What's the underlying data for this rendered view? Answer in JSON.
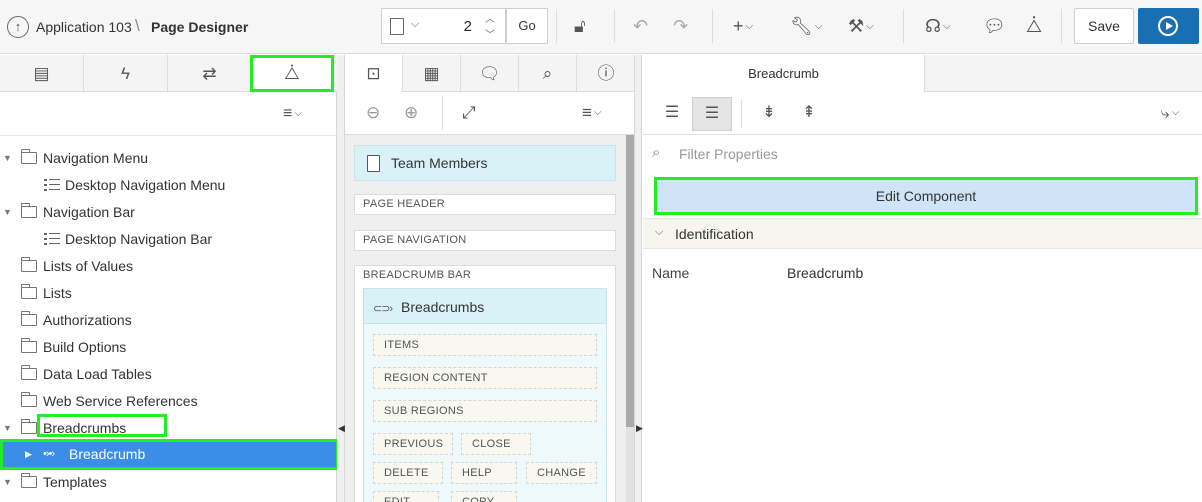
{
  "header": {
    "app_label": "Application 103",
    "separator": "\\",
    "page_label": "Page Designer",
    "page_number": "2",
    "go_label": "Go",
    "save_label": "Save",
    "run_color": "#1a6fb3"
  },
  "left": {
    "tabs": [
      {
        "icon": "rendering-icon",
        "glyph": "▤"
      },
      {
        "icon": "dynamic-actions-icon",
        "glyph": "⚡"
      },
      {
        "icon": "processing-icon",
        "glyph": "⇄"
      },
      {
        "icon": "shared-components-icon",
        "glyph": "⧊"
      }
    ],
    "tree": [
      {
        "label": "Navigation Menu",
        "icon": "folder-open-icon",
        "expanded": true,
        "level": 0
      },
      {
        "label": "Desktop Navigation Menu",
        "icon": "list-icon",
        "level": 1
      },
      {
        "label": "Navigation Bar",
        "icon": "folder-open-icon",
        "expanded": true,
        "level": 0
      },
      {
        "label": "Desktop Navigation Bar",
        "icon": "list-icon",
        "level": 1
      },
      {
        "label": "Lists of Values",
        "icon": "folder-icon",
        "level": 0
      },
      {
        "label": "Lists",
        "icon": "folder-icon",
        "level": 0
      },
      {
        "label": "Authorizations",
        "icon": "folder-icon",
        "level": 0
      },
      {
        "label": "Build Options",
        "icon": "folder-icon",
        "level": 0
      },
      {
        "label": "Data Load Tables",
        "icon": "folder-icon",
        "level": 0
      },
      {
        "label": "Web Service References",
        "icon": "folder-icon",
        "level": 0
      },
      {
        "label": "Breadcrumbs",
        "icon": "folder-open-icon",
        "expanded": true,
        "level": 0
      },
      {
        "label": "Breadcrumb",
        "icon": "breadcrumb-icon",
        "level": 1,
        "selected": true
      },
      {
        "label": "Templates",
        "icon": "folder-open-icon",
        "expanded": true,
        "level": 0
      }
    ]
  },
  "middle": {
    "page_title": "Team Members",
    "positions": [
      "PAGE HEADER",
      "PAGE NAVIGATION"
    ],
    "breadcrumb_bar": "BREADCRUMB BAR",
    "region_title": "Breadcrumbs",
    "slots": [
      "ITEMS",
      "REGION CONTENT",
      "SUB REGIONS"
    ],
    "buttons": [
      "PREVIOUS",
      "CLOSE",
      "DELETE",
      "HELP",
      "CHANGE",
      "EDIT",
      "COPY"
    ]
  },
  "right": {
    "tab_label": "Breadcrumb",
    "filter_placeholder": "Filter Properties",
    "edit_label": "Edit Component",
    "group_label": "Identification",
    "prop_name_label": "Name",
    "prop_name_value": "Breadcrumb"
  },
  "highlight_color": "#22ee22",
  "selection_color": "#3c8de6"
}
